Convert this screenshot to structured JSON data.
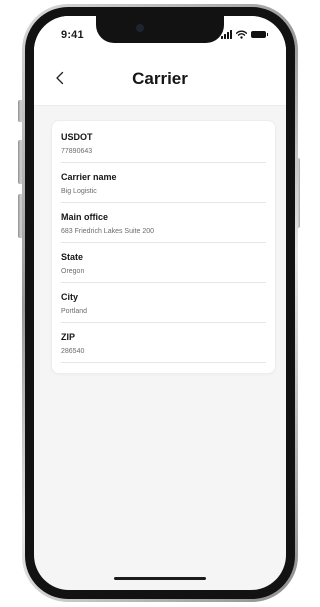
{
  "status_bar": {
    "time": "9:41",
    "icons": [
      "signal-icon",
      "wifi-icon",
      "battery-icon"
    ]
  },
  "header": {
    "title": "Carrier",
    "back_icon": "chevron-left-icon"
  },
  "fields": [
    {
      "label": "USDOT",
      "value": "77890643"
    },
    {
      "label": "Carrier name",
      "value": "Big Logistic"
    },
    {
      "label": "Main office",
      "value": "683 Friedrich Lakes Suite 200"
    },
    {
      "label": "State",
      "value": "Oregon"
    },
    {
      "label": "City",
      "value": "Portland"
    },
    {
      "label": "ZIP",
      "value": "286540"
    }
  ],
  "colors": {
    "screen_background": "#f5f5f5",
    "card_background": "#ffffff",
    "title_text": "#161616",
    "secondary_text": "#6b6b6b",
    "divider": "#e5e5e5"
  }
}
